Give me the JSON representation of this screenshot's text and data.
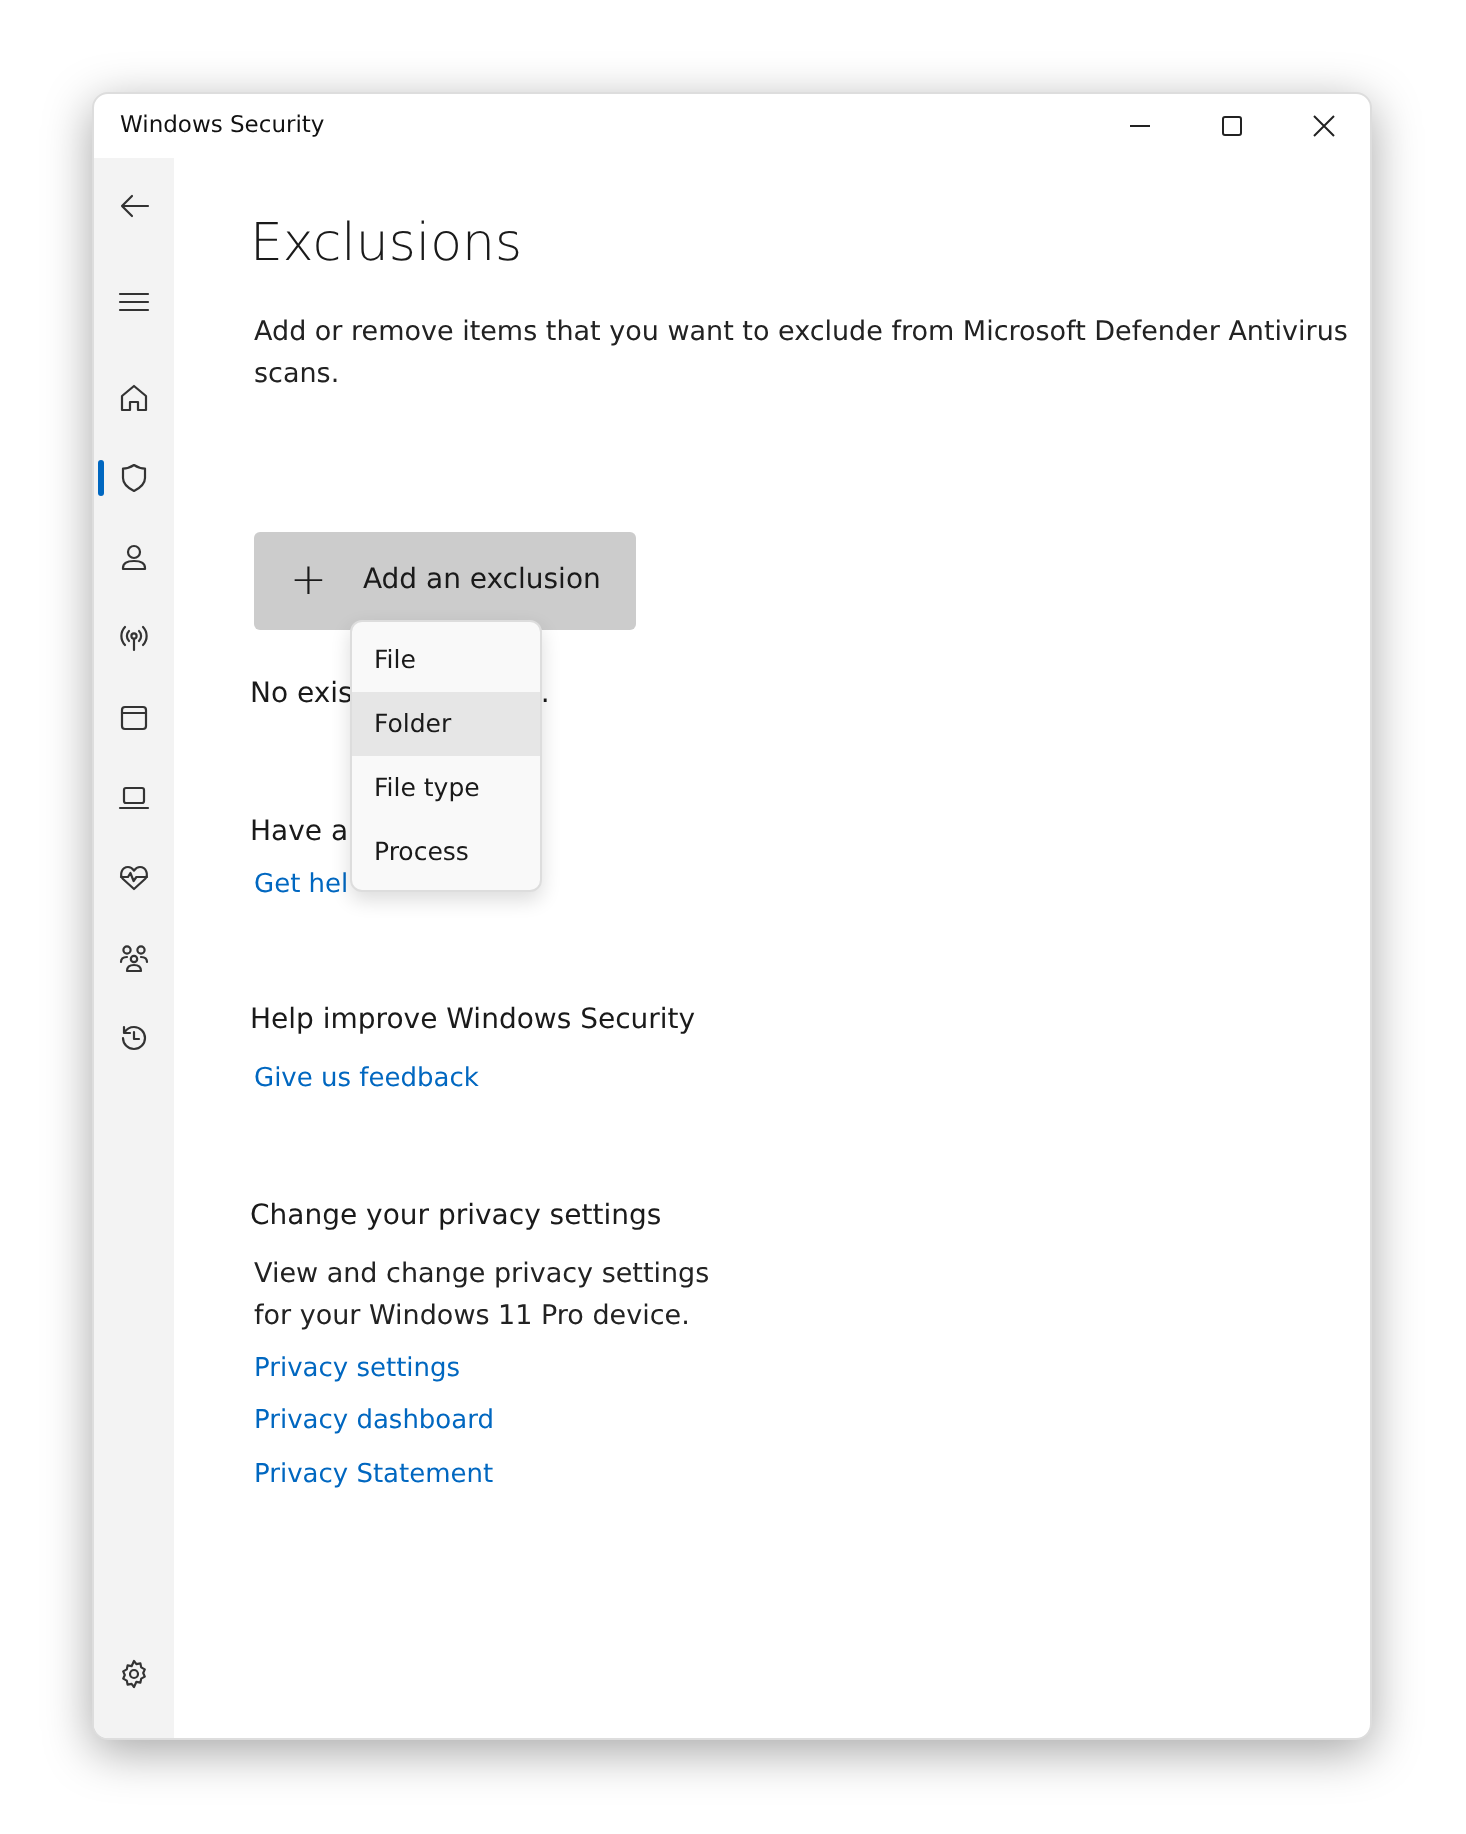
{
  "window": {
    "title": "Windows Security"
  },
  "sidebar": {
    "items": [
      {
        "kind": "back",
        "selected": false
      },
      {
        "kind": "menu",
        "selected": false
      },
      {
        "kind": "home",
        "selected": false
      },
      {
        "kind": "shield",
        "selected": true
      },
      {
        "kind": "person",
        "selected": false
      },
      {
        "kind": "antenna",
        "selected": false
      },
      {
        "kind": "window",
        "selected": false
      },
      {
        "kind": "laptop",
        "selected": false
      },
      {
        "kind": "heart",
        "selected": false
      },
      {
        "kind": "family",
        "selected": false
      },
      {
        "kind": "history",
        "selected": false
      }
    ],
    "settings": {
      "kind": "settings",
      "selected": false
    }
  },
  "page": {
    "title": "Exclusions",
    "description": "Add or remove items that you want to exclude from Microsoft Defender Antivirus scans.",
    "add_button": {
      "icon": "+",
      "label": "Add an exclusion"
    },
    "status_visible_start": "No exis",
    "status_visible_end": ".",
    "question_visible": "Have a",
    "help_link_visible": "Get hel",
    "sections": [
      {
        "heading": "Help improve Windows Security",
        "links": [
          "Give us feedback"
        ]
      },
      {
        "heading": "Change your privacy settings",
        "text": "View and change privacy settings for your Windows 11 Pro device.",
        "links": [
          "Privacy settings",
          "Privacy dashboard",
          "Privacy Statement"
        ]
      }
    ]
  },
  "dropdown_menu": {
    "items": [
      {
        "label": "File",
        "selected": false
      },
      {
        "label": "Folder",
        "selected": true
      },
      {
        "label": "File type",
        "selected": false
      },
      {
        "label": "Process",
        "selected": false
      }
    ]
  }
}
